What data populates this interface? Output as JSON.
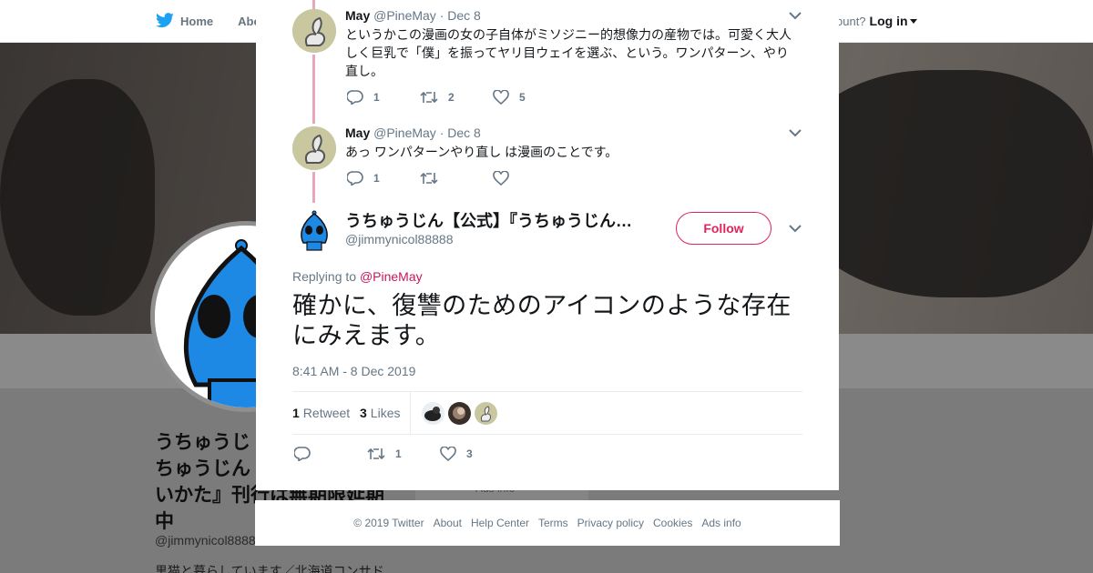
{
  "nav": {
    "home": "Home",
    "about": "Abo",
    "account_prompt": "ccount?",
    "login": "Log in"
  },
  "profile": {
    "name": "うちゅうじ\nちゅうじん\nいかた』刊行は無期限延期\n中",
    "handle": "@jimmynicol8888",
    "bio": "黒猫と暮らしています／北海道コンサド",
    "side_card": "Ads info"
  },
  "thread": [
    {
      "name": "May",
      "handle": "@PineMay",
      "sep": "·",
      "date": "Dec 8",
      "text": "というかこの漫画の女の子自体がミソジニー的想像力の産物では。可愛く大人しく巨乳で「僕」を振ってヤリ目ウェイを選ぶ、という。ワンパターン、やり直し。",
      "replies": "1",
      "retweets": "2",
      "likes": "5"
    },
    {
      "name": "May",
      "handle": "@PineMay",
      "sep": "·",
      "date": "Dec 8",
      "text": "あっ ワンパターンやり直し は漫画のことです。",
      "replies": "1",
      "retweets": "",
      "likes": ""
    }
  ],
  "main_tweet": {
    "name": "うちゅうじん【公式】『うちゅうじん…",
    "handle": "@jimmynicol88888",
    "follow": "Follow",
    "replying_prefix": "Replying to",
    "replying_to": "@PineMay",
    "text": "確かに、復讐のためのアイコンのような存在にみえます。",
    "timestamp": "8:41 AM - 8 Dec 2019",
    "retweet_count": "1",
    "retweet_label": "Retweet",
    "like_count": "3",
    "like_label": "Likes",
    "replies": "",
    "retweets": "1",
    "likes": "3"
  },
  "footer": {
    "copyright": "© 2019 Twitter",
    "links": [
      "About",
      "Help Center",
      "Terms",
      "Privacy policy",
      "Cookies",
      "Ads info"
    ]
  },
  "colors": {
    "accent": "#e0245e",
    "thread_line": "#e9a7b9",
    "twitter_blue": "#1da1f2",
    "overlay": "#7a7a7a"
  },
  "icons": [
    "twitter-bird-icon",
    "close-icon",
    "chevron-down-icon",
    "reply-icon",
    "retweet-icon",
    "heart-icon"
  ]
}
